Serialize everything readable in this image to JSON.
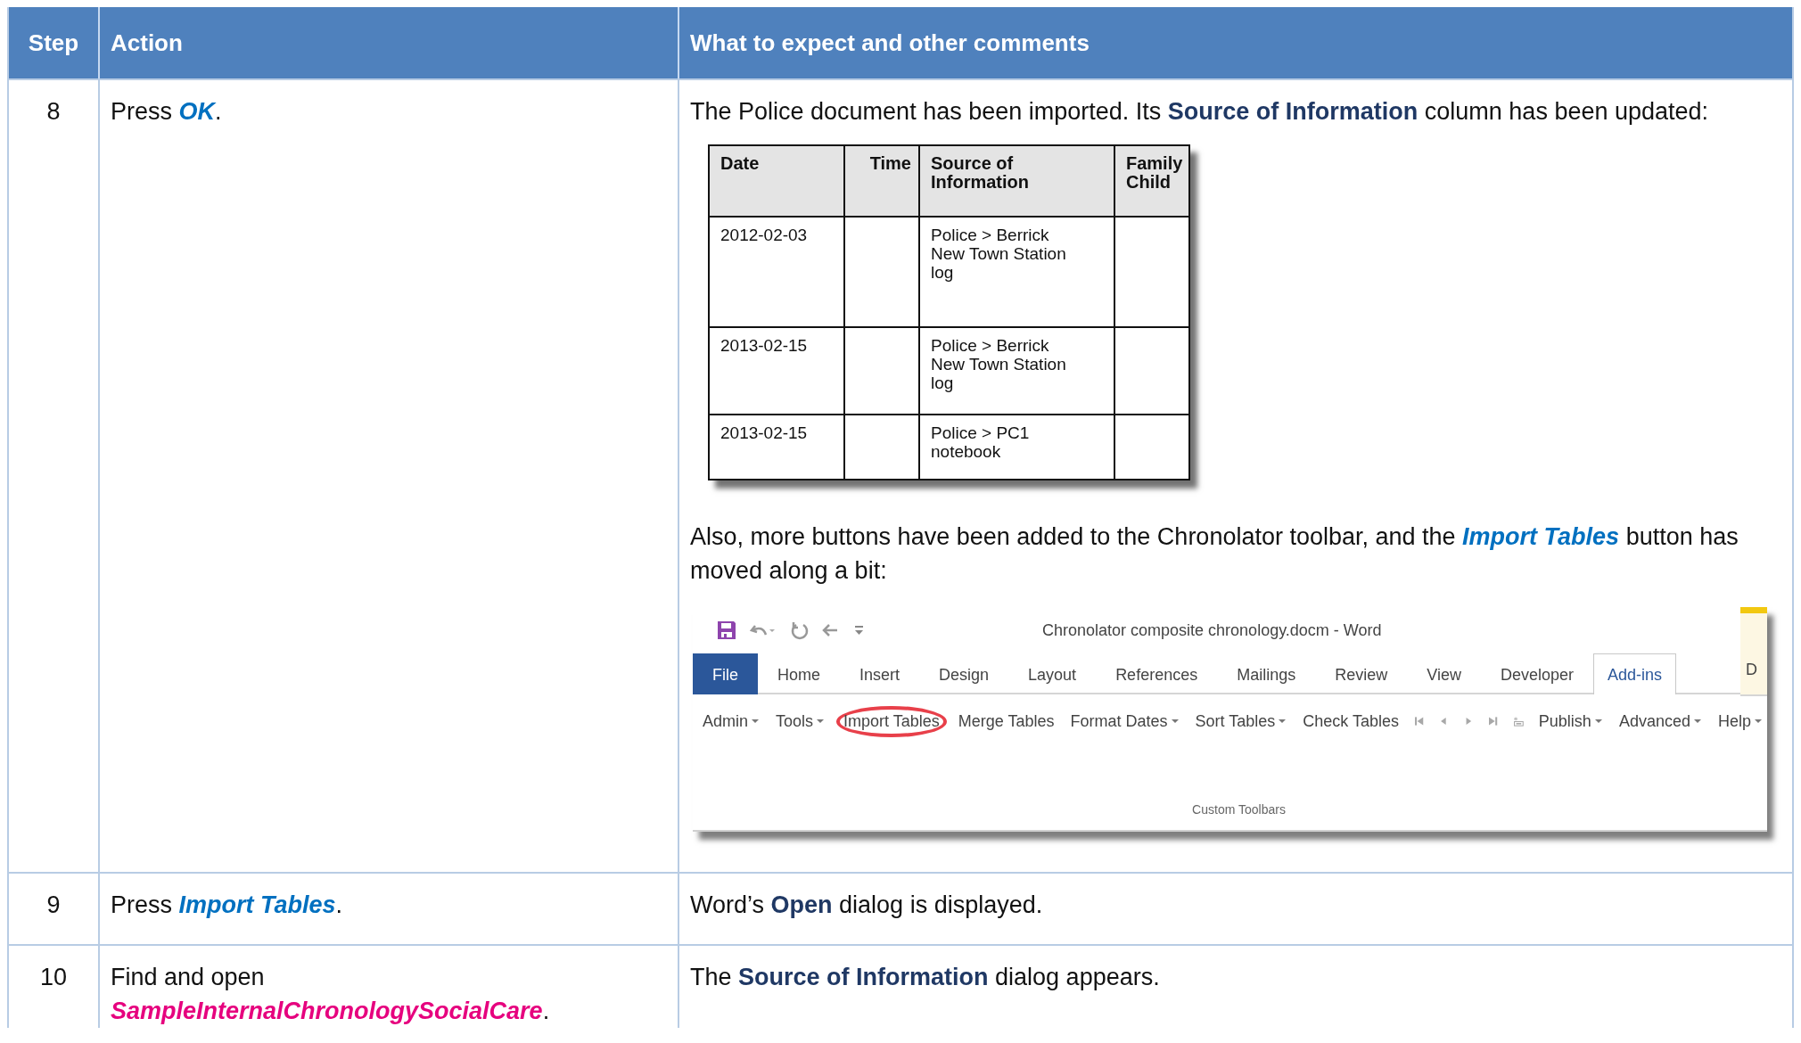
{
  "columns": [
    "Step",
    "Action",
    "What to expect and other comments"
  ],
  "steps": [
    {
      "step": "8",
      "action": "Press *OK*.",
      "comments": [
        {
          "kind": "text",
          "text": "The Police document has been imported. Its **Source of Information** column has been updated:"
        },
        {
          "kind": "table",
          "columns": [
            "Date",
            "Time",
            "Source of Information",
            "Family Child"
          ],
          "rows": [
            {
              "date": "2012-02-03",
              "source": "Police > Berrick New Town Station log"
            },
            {
              "date": "2013-02-15",
              "source": "Police > Berrick New Town Station log"
            },
            {
              "date": "2013-02-15",
              "source": "Police > PC1 notebook"
            }
          ]
        },
        {
          "kind": "text",
          "text": "Also, more buttons have been added to the Chronolator toolbar, and the *Import Tables* button has moved along a bit:"
        },
        {
          "kind": "ribbon",
          "title": "Chronolator composite chronology.docm - Word",
          "tabs": [
            {
              "label": "File",
              "kind": "file",
              "selected": false
            },
            {
              "label": "Home",
              "kind": "tab",
              "selected": false
            },
            {
              "label": "Insert",
              "kind": "tab",
              "selected": false
            },
            {
              "label": "Design",
              "kind": "tab",
              "selected": false
            },
            {
              "label": "Layout",
              "kind": "tab",
              "selected": false
            },
            {
              "label": "References",
              "kind": "tab",
              "selected": false
            },
            {
              "label": "Mailings",
              "kind": "tab",
              "selected": false
            },
            {
              "label": "Review",
              "kind": "tab",
              "selected": false
            },
            {
              "label": "View",
              "kind": "tab",
              "selected": false
            },
            {
              "label": "Developer",
              "kind": "tab",
              "selected": false
            },
            {
              "label": "Add-ins",
              "kind": "tab",
              "selected": true
            },
            {
              "label": "D",
              "kind": "contextual",
              "selected": false
            }
          ],
          "commands": [
            {
              "kind": "menu",
              "label": "Admin",
              "highlighted": false
            },
            {
              "kind": "menu",
              "label": "Tools",
              "highlighted": false
            },
            {
              "kind": "button",
              "label": "Import Tables",
              "highlighted": true
            },
            {
              "kind": "button",
              "label": "Merge Tables",
              "highlighted": false
            },
            {
              "kind": "menu",
              "label": "Format Dates",
              "highlighted": false
            },
            {
              "kind": "menu",
              "label": "Sort Tables",
              "highlighted": false
            },
            {
              "kind": "button",
              "label": "Check Tables",
              "highlighted": false
            },
            {
              "kind": "first",
              "disabled": true
            },
            {
              "kind": "previous",
              "disabled": true
            },
            {
              "kind": "next",
              "disabled": true
            },
            {
              "kind": "last",
              "disabled": true
            },
            {
              "kind": "insert",
              "disabled": true
            },
            {
              "kind": "menu",
              "label": "Publish",
              "highlighted": false
            },
            {
              "kind": "menu",
              "label": "Advanced",
              "highlighted": false
            },
            {
              "kind": "menu",
              "label": "Help",
              "highlighted": false
            }
          ],
          "group": "Custom Toolbars"
        }
      ]
    },
    {
      "step": "9",
      "action": "Press *Import Tables*.",
      "comments": [
        {
          "kind": "text",
          "text": "Word’s **Open** dialog is displayed."
        }
      ]
    },
    {
      "step": "10",
      "action": "Find and open\n**SampleInternalChronologySocialCare**.",
      "comments": [
        {
          "kind": "text",
          "text": "The **Source of Information** dialog appears."
        }
      ]
    }
  ]
}
